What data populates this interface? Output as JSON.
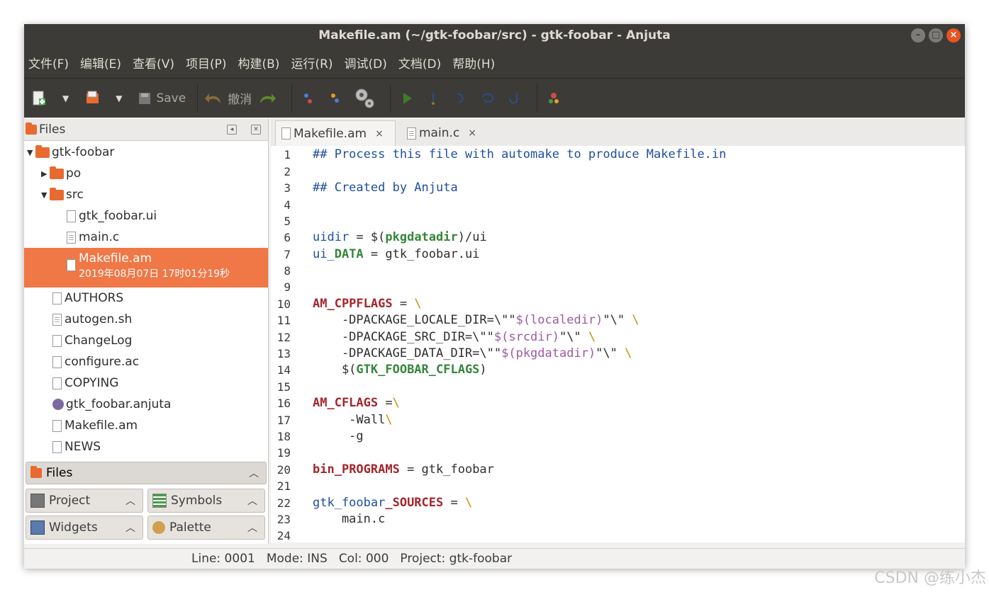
{
  "window": {
    "title": "Makefile.am (~/gtk-foobar/src) - gtk-foobar - Anjuta",
    "controls": [
      "minimize",
      "maximize",
      "close"
    ]
  },
  "menu": [
    "文件(F)",
    "编辑(E)",
    "查看(V)",
    "项目(P)",
    "构建(B)",
    "运行(R)",
    "调试(D)",
    "文档(D)",
    "帮助(H)"
  ],
  "toolbar": {
    "save_label": "Save",
    "undo_label": "撤消"
  },
  "files_panel": {
    "title": "Files",
    "tree": [
      {
        "label": "gtk-foobar",
        "type": "folder",
        "expanded": true
      },
      {
        "label": "po",
        "type": "folder",
        "expanded": false
      },
      {
        "label": "src",
        "type": "folder",
        "expanded": true
      },
      {
        "label": "gtk_foobar.ui",
        "type": "file"
      },
      {
        "label": "main.c",
        "type": "file"
      },
      {
        "label": "Makefile.am",
        "type": "file",
        "selected": true,
        "detail": "2019年08月07日  17时01分19秒"
      },
      {
        "label": "AUTHORS",
        "type": "file"
      },
      {
        "label": "autogen.sh",
        "type": "file"
      },
      {
        "label": "ChangeLog",
        "type": "file"
      },
      {
        "label": "configure.ac",
        "type": "file"
      },
      {
        "label": "COPYING",
        "type": "file"
      },
      {
        "label": "gtk_foobar.anjuta",
        "type": "file"
      },
      {
        "label": "Makefile.am",
        "type": "file"
      },
      {
        "label": "NEWS",
        "type": "file"
      }
    ]
  },
  "dock": {
    "files": "Files",
    "project": "Project",
    "symbols": "Symbols",
    "widgets": "Widgets",
    "palette": "Palette"
  },
  "tabs": [
    {
      "label": "Makefile.am",
      "close": "×",
      "active": true
    },
    {
      "label": "main.c",
      "close": "×",
      "active": false
    }
  ],
  "editor": {
    "line_numbers": [
      "1",
      "2",
      "3",
      "4",
      "5",
      "6",
      "7",
      "8",
      "9",
      "10",
      "11",
      "12",
      "13",
      "14",
      "15",
      "16",
      "17",
      "18",
      "19",
      "20",
      "21",
      "22",
      "23",
      "24"
    ],
    "l1": "## Process this file with automake to produce Makefile.in",
    "l3": "## Created by Anjuta",
    "l6a": "uidir",
    "l6b": " = $(",
    "l6c": "pkgdatadir",
    "l6d": ")/ui",
    "l7a": "ui_",
    "l7b": "DATA",
    "l7c": " = gtk_foobar.ui",
    "l10a": "AM_CPPFLAGS",
    "l10b": " = ",
    "l10c": "\\",
    "l11a": "    -DPACKAGE_LOCALE_DIR=\\\"\"",
    "l11b": "$(localedir)",
    "l11c": "\"\\\" ",
    "l11d": "\\",
    "l12a": "    -DPACKAGE_SRC_DIR=\\\"\"",
    "l12b": "$(srcdir)",
    "l12c": "\"\\\" ",
    "l12d": "\\",
    "l13a": "    -DPACKAGE_DATA_DIR=\\\"\"",
    "l13b": "$(pkgdatadir)",
    "l13c": "\"\\\" ",
    "l13d": "\\",
    "l14a": "    $(",
    "l14b": "GTK_FOOBAR_CFLAGS",
    "l14c": ")",
    "l16a": "AM_CFLAGS",
    "l16b": " =",
    "l16c": "\\",
    "l17a": "     -Wall",
    "l17b": "\\",
    "l18": "     -g",
    "l20a": "bin_",
    "l20b": "PROGRAMS",
    "l20c": " = gtk_foobar",
    "l22a": "gtk_foobar",
    "l22b": "_SOURCES",
    "l22c": " = ",
    "l22d": "\\",
    "l23": "    main.c"
  },
  "status": {
    "line": "Line: 0001",
    "mode": "Mode: INS",
    "col": "Col: 000",
    "project": "Project: gtk-foobar"
  },
  "watermark": "CSDN @练小杰"
}
